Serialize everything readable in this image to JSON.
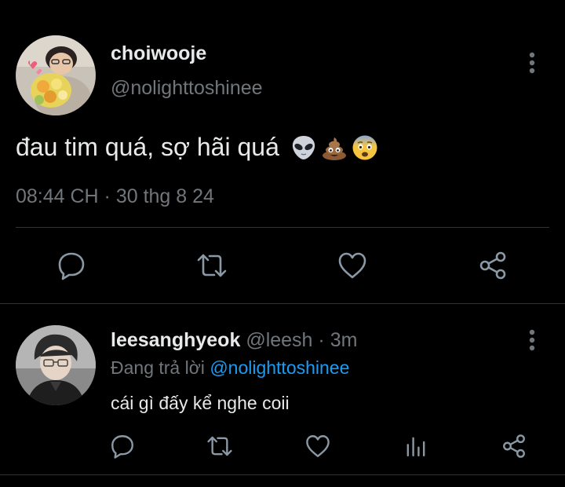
{
  "colors": {
    "background": "#000000",
    "primary_text": "#e7e9ea",
    "secondary_text": "#71767b",
    "link": "#1d9bf0",
    "divider": "#2f3336"
  },
  "main_tweet": {
    "display_name": "choiwooje",
    "handle": "@nolighttoshinee",
    "text": "đau tim quá, sợ hãi quá",
    "emojis": [
      "alien-emoji",
      "poop-emoji",
      "fearful-face-emoji"
    ],
    "timestamp": "08:44 CH · 30 thg 8 24",
    "actions": [
      "reply-icon",
      "retweet-icon",
      "like-icon",
      "share-icon"
    ]
  },
  "reply": {
    "display_name": "leesanghyeok",
    "handle": "@leesh",
    "separator": " · ",
    "time": "3m",
    "replying_to_label": "Đang trả lời",
    "replying_to_handle": "@nolighttoshinee",
    "text": "cái gì đấy kể nghe coii",
    "actions": [
      "reply-icon",
      "retweet-icon",
      "like-icon",
      "views-icon",
      "share-icon"
    ]
  }
}
